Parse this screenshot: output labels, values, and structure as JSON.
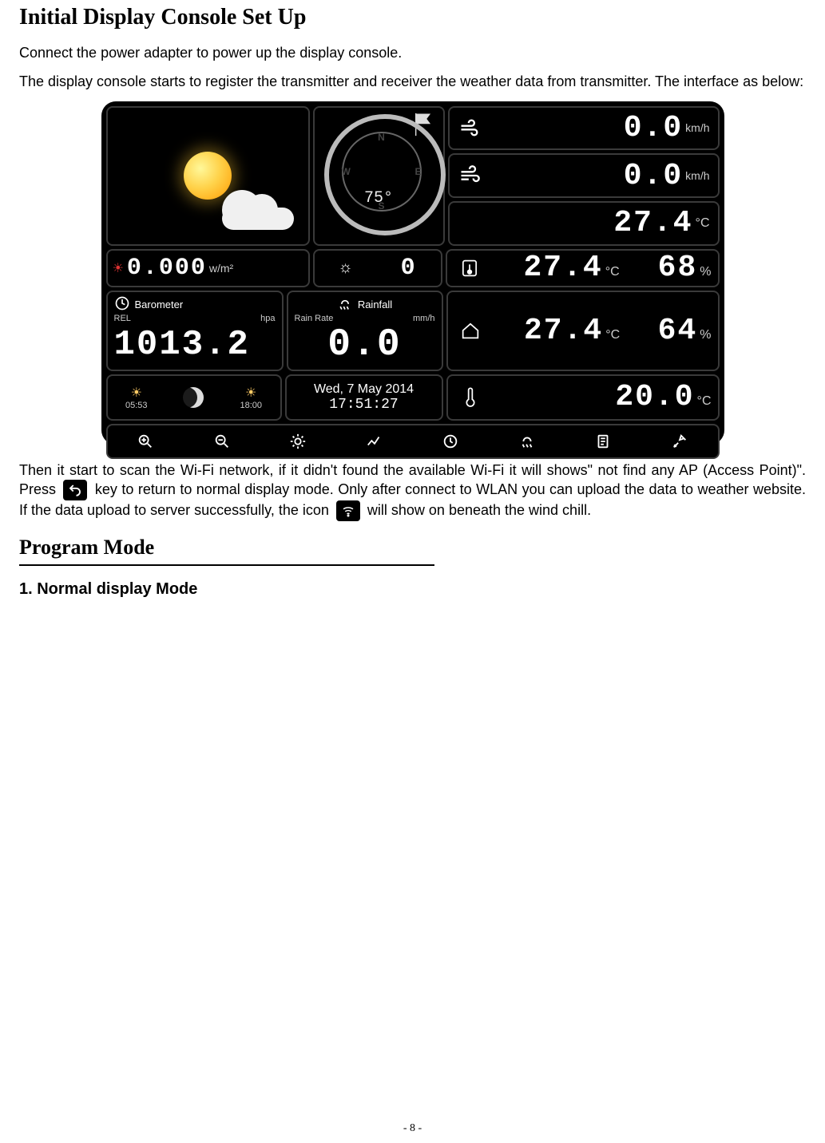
{
  "headings": {
    "title": "Initial Display Console Set Up",
    "program_mode": "Program Mode",
    "normal_display": "1.  Normal display Mode"
  },
  "paragraphs": {
    "p1": "Connect the power adapter to power up the display console.",
    "p2": "The display console starts to register the transmitter and receiver the weather data from transmitter. The interface as below:",
    "p3a": "Then it start to scan the Wi-Fi network, if it didn't found the available Wi-Fi it will shows\" not find any AP (Access Point)\". Press ",
    "p3b": " key to return to normal display mode. Only after connect to WLAN you can upload the data to weather website. If the data upload to server successfully, the icon ",
    "p3c": " will show on beneath the wind chill."
  },
  "page_number": "- 8 -",
  "console": {
    "compass": {
      "n": "N",
      "s": "S",
      "e": "E",
      "w": "W",
      "value": "75",
      "unit": "°"
    },
    "wind": {
      "speed": "0.0",
      "gust": "0.0",
      "unit": "km/h"
    },
    "solar": {
      "value": "0.000",
      "unit": "w/m²"
    },
    "uvi": {
      "label_icon": "sun-icon",
      "value": "0"
    },
    "wind_chill": {
      "value": "27.4",
      "unit": "°C"
    },
    "barometer": {
      "label": "Barometer",
      "sub_left": "REL",
      "sub_right": "hpa",
      "value": "1013.2"
    },
    "rainfall": {
      "label": "Rainfall",
      "sub_left": "Rain Rate",
      "sub_right": "mm/h",
      "value": "0.0"
    },
    "indoor": {
      "temp": "27.4",
      "temp_unit": "°C",
      "hum": "68",
      "hum_unit": "%"
    },
    "outdoor": {
      "temp": "27.4",
      "temp_unit": "°C",
      "hum": "64",
      "hum_unit": "%"
    },
    "sun": {
      "rise": "05:53",
      "set": "18:00"
    },
    "datetime": {
      "date": "Wed, 7 May 2014",
      "time": "17:51:27"
    },
    "dewpoint": {
      "value": "20.0",
      "unit": "°C"
    }
  }
}
